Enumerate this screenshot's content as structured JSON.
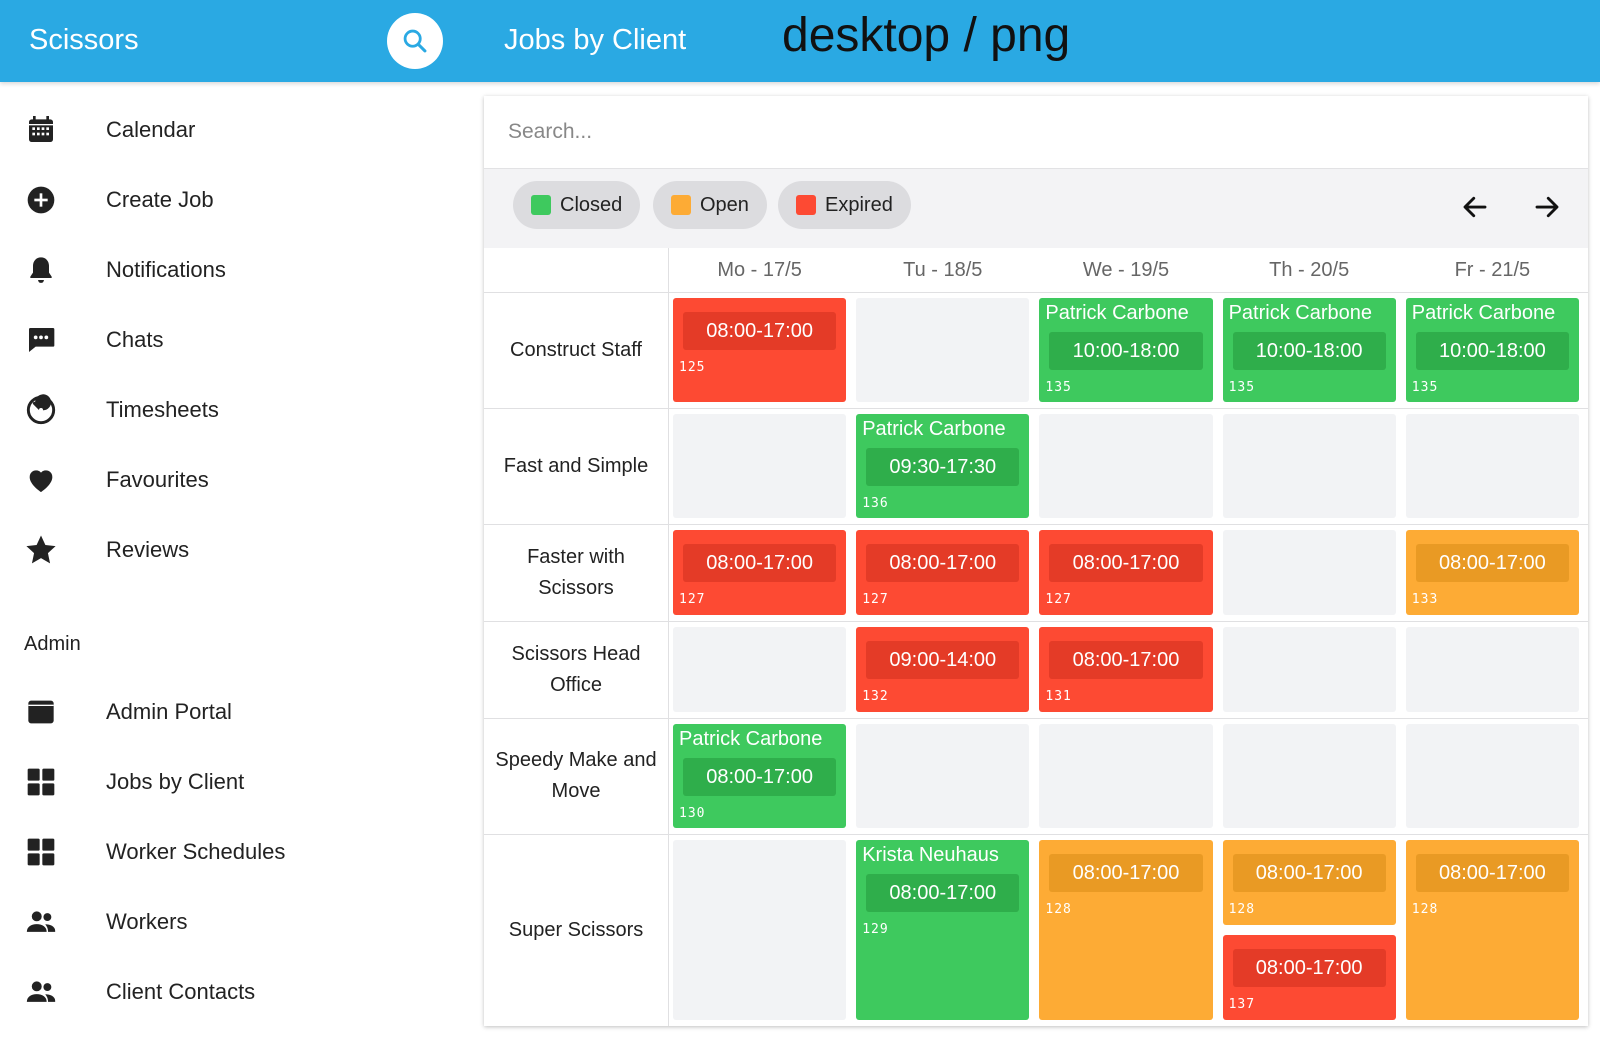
{
  "app": {
    "title": "Scissors",
    "page_title": "Jobs by Client",
    "overlay_text": "desktop / png"
  },
  "sidebar": {
    "items": [
      {
        "label": "Calendar",
        "icon": "calendar-icon"
      },
      {
        "label": "Create Job",
        "icon": "plus-circle-icon"
      },
      {
        "label": "Notifications",
        "icon": "bell-icon"
      },
      {
        "label": "Chats",
        "icon": "chat-icon"
      },
      {
        "label": "Timesheets",
        "icon": "timer-icon"
      },
      {
        "label": "Favourites",
        "icon": "heart-icon"
      },
      {
        "label": "Reviews",
        "icon": "star-icon"
      }
    ],
    "admin_label": "Admin",
    "admin_items": [
      {
        "label": "Admin Portal",
        "icon": "window-icon"
      },
      {
        "label": "Jobs by Client",
        "icon": "grid-icon"
      },
      {
        "label": "Worker Schedules",
        "icon": "grid-icon"
      },
      {
        "label": "Workers",
        "icon": "people-icon"
      },
      {
        "label": "Client Contacts",
        "icon": "people-icon"
      }
    ]
  },
  "search": {
    "placeholder": "Search...",
    "value": ""
  },
  "filters": [
    {
      "label": "Closed",
      "color": "#3ec95e"
    },
    {
      "label": "Open",
      "color": "#fdab35"
    },
    {
      "label": "Expired",
      "color": "#fd4a33"
    }
  ],
  "days": [
    "Mo - 17/5",
    "Tu - 18/5",
    "We - 19/5",
    "Th - 20/5",
    "Fr - 21/5"
  ],
  "clients": [
    {
      "name": "Construct Staff",
      "jobs": [
        {
          "day": 0,
          "status": "expired",
          "worker": "",
          "time": "08:00-17:00",
          "id": "125"
        },
        {
          "day": 2,
          "status": "closed",
          "worker": "Patrick Carbone",
          "time": "10:00-18:00",
          "id": "135"
        },
        {
          "day": 3,
          "status": "closed",
          "worker": "Patrick Carbone",
          "time": "10:00-18:00",
          "id": "135"
        },
        {
          "day": 4,
          "status": "closed",
          "worker": "Patrick Carbone",
          "time": "10:00-18:00",
          "id": "135"
        }
      ]
    },
    {
      "name": "Fast and Simple",
      "jobs": [
        {
          "day": 1,
          "status": "closed",
          "worker": "Patrick Carbone",
          "time": "09:30-17:30",
          "id": "136"
        }
      ]
    },
    {
      "name": "Faster with Scissors",
      "jobs": [
        {
          "day": 0,
          "status": "expired",
          "worker": "",
          "time": "08:00-17:00",
          "id": "127"
        },
        {
          "day": 1,
          "status": "expired",
          "worker": "",
          "time": "08:00-17:00",
          "id": "127"
        },
        {
          "day": 2,
          "status": "expired",
          "worker": "",
          "time": "08:00-17:00",
          "id": "127"
        },
        {
          "day": 4,
          "status": "open",
          "worker": "",
          "time": "08:00-17:00",
          "id": "133"
        }
      ]
    },
    {
      "name": "Scissors Head Office",
      "jobs": [
        {
          "day": 1,
          "status": "expired",
          "worker": "",
          "time": "09:00-14:00",
          "id": "132"
        },
        {
          "day": 2,
          "status": "expired",
          "worker": "",
          "time": "08:00-17:00",
          "id": "131"
        }
      ]
    },
    {
      "name": "Speedy Make and Move",
      "jobs": [
        {
          "day": 0,
          "status": "closed",
          "worker": "Patrick Carbone",
          "time": "08:00-17:00",
          "id": "130"
        }
      ]
    },
    {
      "name": "Super Scissors",
      "jobs": [
        {
          "day": 1,
          "status": "closed",
          "worker": "Krista Neuhaus",
          "time": "08:00-17:00",
          "id": "129"
        },
        {
          "day": 2,
          "status": "open",
          "worker": "",
          "time": "08:00-17:00",
          "id": "128"
        },
        {
          "day": 3,
          "status": "open",
          "worker": "",
          "time": "08:00-17:00",
          "id": "128"
        },
        {
          "day": 3,
          "status": "expired",
          "worker": "",
          "time": "08:00-17:00",
          "id": "137"
        },
        {
          "day": 4,
          "status": "open",
          "worker": "",
          "time": "08:00-17:00",
          "id": "128"
        }
      ]
    }
  ]
}
